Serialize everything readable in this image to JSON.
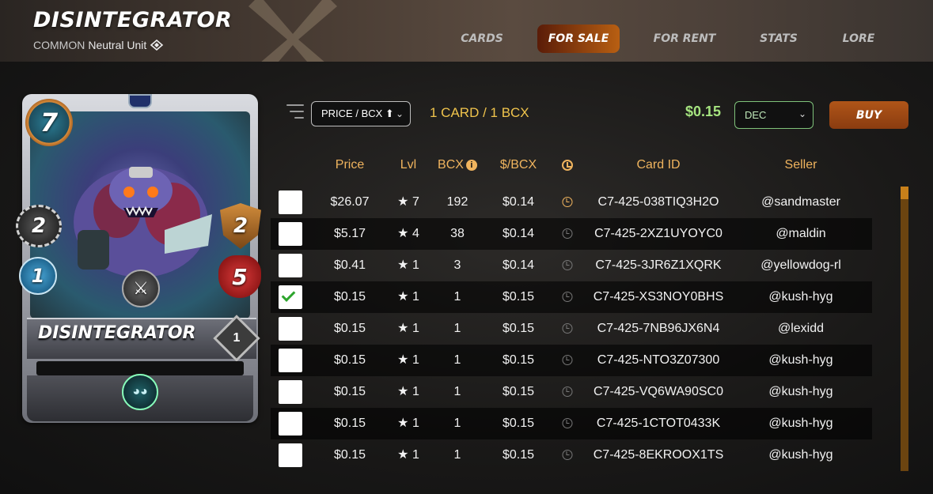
{
  "header": {
    "title": "DISINTEGRATOR",
    "rarity": "COMMON",
    "unit_type": "Neutral Unit"
  },
  "nav": [
    {
      "label": "CARDS",
      "active": false
    },
    {
      "label": "FOR SALE",
      "active": true
    },
    {
      "label": "FOR RENT",
      "active": false
    },
    {
      "label": "STATS",
      "active": false
    },
    {
      "label": "LORE",
      "active": false
    }
  ],
  "card": {
    "name": "DISINTEGRATOR",
    "mana": "7",
    "attack": "2",
    "armor": "2",
    "speed": "1",
    "health": "5",
    "level": "1"
  },
  "toolbar": {
    "sort_value": "PRICE / BCX ⬆",
    "card_count": "1 CARD / 1 BCX",
    "total_price": "$0.15",
    "currency_value": "DEC",
    "buy_label": "BUY"
  },
  "table": {
    "headers": {
      "price": "Price",
      "lvl": "Lvl",
      "bcx": "BCX",
      "per_bcx": "$/BCX",
      "card_id": "Card ID",
      "seller": "Seller"
    },
    "rows": [
      {
        "checked": false,
        "price": "$26.07",
        "lvl": "★ 7",
        "bcx": "192",
        "per_bcx": "$0.14",
        "card_id": "C7-425-038TIQ3H2O",
        "seller": "@sandmaster"
      },
      {
        "checked": false,
        "price": "$5.17",
        "lvl": "★ 4",
        "bcx": "38",
        "per_bcx": "$0.14",
        "card_id": "C7-425-2XZ1UYOYC0",
        "seller": "@maldin"
      },
      {
        "checked": false,
        "price": "$0.41",
        "lvl": "★ 1",
        "bcx": "3",
        "per_bcx": "$0.14",
        "card_id": "C7-425-3JR6Z1XQRK",
        "seller": "@yellowdog-rl"
      },
      {
        "checked": true,
        "price": "$0.15",
        "lvl": "★ 1",
        "bcx": "1",
        "per_bcx": "$0.15",
        "card_id": "C7-425-XS3NOY0BHS",
        "seller": "@kush-hyg"
      },
      {
        "checked": false,
        "price": "$0.15",
        "lvl": "★ 1",
        "bcx": "1",
        "per_bcx": "$0.15",
        "card_id": "C7-425-7NB96JX6N4",
        "seller": "@lexidd"
      },
      {
        "checked": false,
        "price": "$0.15",
        "lvl": "★ 1",
        "bcx": "1",
        "per_bcx": "$0.15",
        "card_id": "C7-425-NTO3Z07300",
        "seller": "@kush-hyg"
      },
      {
        "checked": false,
        "price": "$0.15",
        "lvl": "★ 1",
        "bcx": "1",
        "per_bcx": "$0.15",
        "card_id": "C7-425-VQ6WA90SC0",
        "seller": "@kush-hyg"
      },
      {
        "checked": false,
        "price": "$0.15",
        "lvl": "★ 1",
        "bcx": "1",
        "per_bcx": "$0.15",
        "card_id": "C7-425-1CTOT0433K",
        "seller": "@kush-hyg"
      },
      {
        "checked": false,
        "price": "$0.15",
        "lvl": "★ 1",
        "bcx": "1",
        "per_bcx": "$0.15",
        "card_id": "C7-425-8EKROOX1TS",
        "seller": "@kush-hyg"
      }
    ]
  },
  "colors": {
    "accent_gold": "#f0b45e",
    "price_green": "#a5e37f",
    "buy_orange": "#b05518"
  },
  "icons": {
    "element": "neutral-element-icon",
    "filter": "filter-lines-icon",
    "clock": "clock-icon"
  }
}
